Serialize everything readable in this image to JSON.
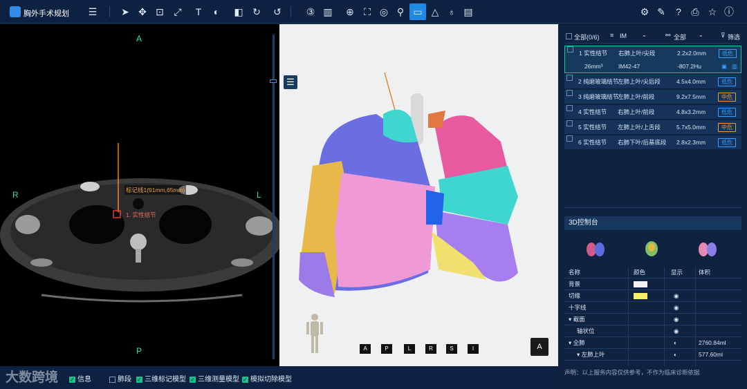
{
  "app": {
    "title": "胸外手术规划"
  },
  "toolbar": {
    "icons": [
      "menu-icon",
      "pointer-icon",
      "move-icon",
      "zoom-icon",
      "measure-line-icon",
      "text-icon",
      "window-level-icon",
      "invert-icon",
      "rotate-icon",
      "reset-icon",
      "3d-icon",
      "layout-icon",
      "crosshair-icon",
      "fit-icon",
      "compass-icon",
      "marker-icon",
      "ruler-icon",
      "cone-icon",
      "balloon-icon",
      "report-icon",
      "settings-icon",
      "edit-icon",
      "help-icon",
      "folder-icon",
      "star-icon",
      "info-icon"
    ],
    "text_tool": "T"
  },
  "ct": {
    "orientation": {
      "top": "A",
      "bottom": "P",
      "left": "R",
      "right": "L"
    },
    "annotation": "标记线1(91mm,65mm)",
    "nodule_label": "1. 实性结节"
  },
  "view3d": {
    "view_buttons": [
      "A",
      "P",
      "L",
      "R",
      "S",
      "I"
    ],
    "current_view": "A"
  },
  "filter": {
    "all_label": "全部(0/6)",
    "im_label": "IM",
    "type_label": "全部",
    "filter_btn": "筛选"
  },
  "nodules": [
    {
      "name": "1 实性结节",
      "location": "右肺上叶/尖段",
      "size": "2.2x2.0mm",
      "risk": "低危",
      "volume": "26mm³",
      "slice": "IM42-47",
      "hu": "-807.2Hu"
    },
    {
      "name": "2 纯磨玻璃结节",
      "location": "左肺上叶/尖后段",
      "size": "4.5x4.0mm",
      "risk": "低危"
    },
    {
      "name": "3 纯磨玻璃结节",
      "location": "左肺上叶/前段",
      "size": "9.2x7.5mm",
      "risk": "中危"
    },
    {
      "name": "4 实性结节",
      "location": "右肺上叶/前段",
      "size": "4.8x3.2mm",
      "risk": "低危"
    },
    {
      "name": "5 实性结节",
      "location": "左肺上叶/上舌段",
      "size": "5.7x5.0mm",
      "risk": "中危"
    },
    {
      "name": "6 实性结节",
      "location": "右肺下叶/后基底段",
      "size": "2.8x2.3mm",
      "risk": "低危"
    }
  ],
  "control3d": {
    "title": "3D控制台",
    "headers": {
      "name": "名称",
      "color": "颜色",
      "show": "显示",
      "volume": "体积"
    },
    "rows": [
      {
        "name": "背景",
        "color": "#f2f2f2",
        "show": "",
        "volume": ""
      },
      {
        "name": "切缘",
        "color": "#f7ef6a",
        "show": "◉",
        "volume": ""
      },
      {
        "name": "十字线",
        "color": "",
        "show": "◉",
        "volume": ""
      },
      {
        "name": "▾ 截面",
        "color": "",
        "show": "◉",
        "volume": ""
      },
      {
        "name": "轴状位",
        "color": "",
        "show": "◉",
        "volume": ""
      },
      {
        "name": "▾ 全肺",
        "color": "",
        "show": "◐",
        "volume": "2760.84ml"
      },
      {
        "name": "▾ 左肺上叶",
        "color": "",
        "show": "◐",
        "volume": "577.60ml"
      }
    ]
  },
  "bottom": {
    "items": [
      {
        "label": "信息",
        "checked": true
      },
      {
        "label": "肺段",
        "checked": false
      },
      {
        "label": "三维标记模型",
        "checked": true
      },
      {
        "label": "三维测量模型",
        "checked": true
      },
      {
        "label": "模拟切除模型",
        "checked": true
      }
    ],
    "watermark": "大数跨境",
    "disclaimer": "声明：以上服务内容仅供参考，不作为临床诊断依据"
  },
  "colors": {
    "accent": "#1e8ae6",
    "low_risk": "#3aa0ff",
    "mid_risk": "#e0a23a",
    "bg": "#0b1c33"
  }
}
